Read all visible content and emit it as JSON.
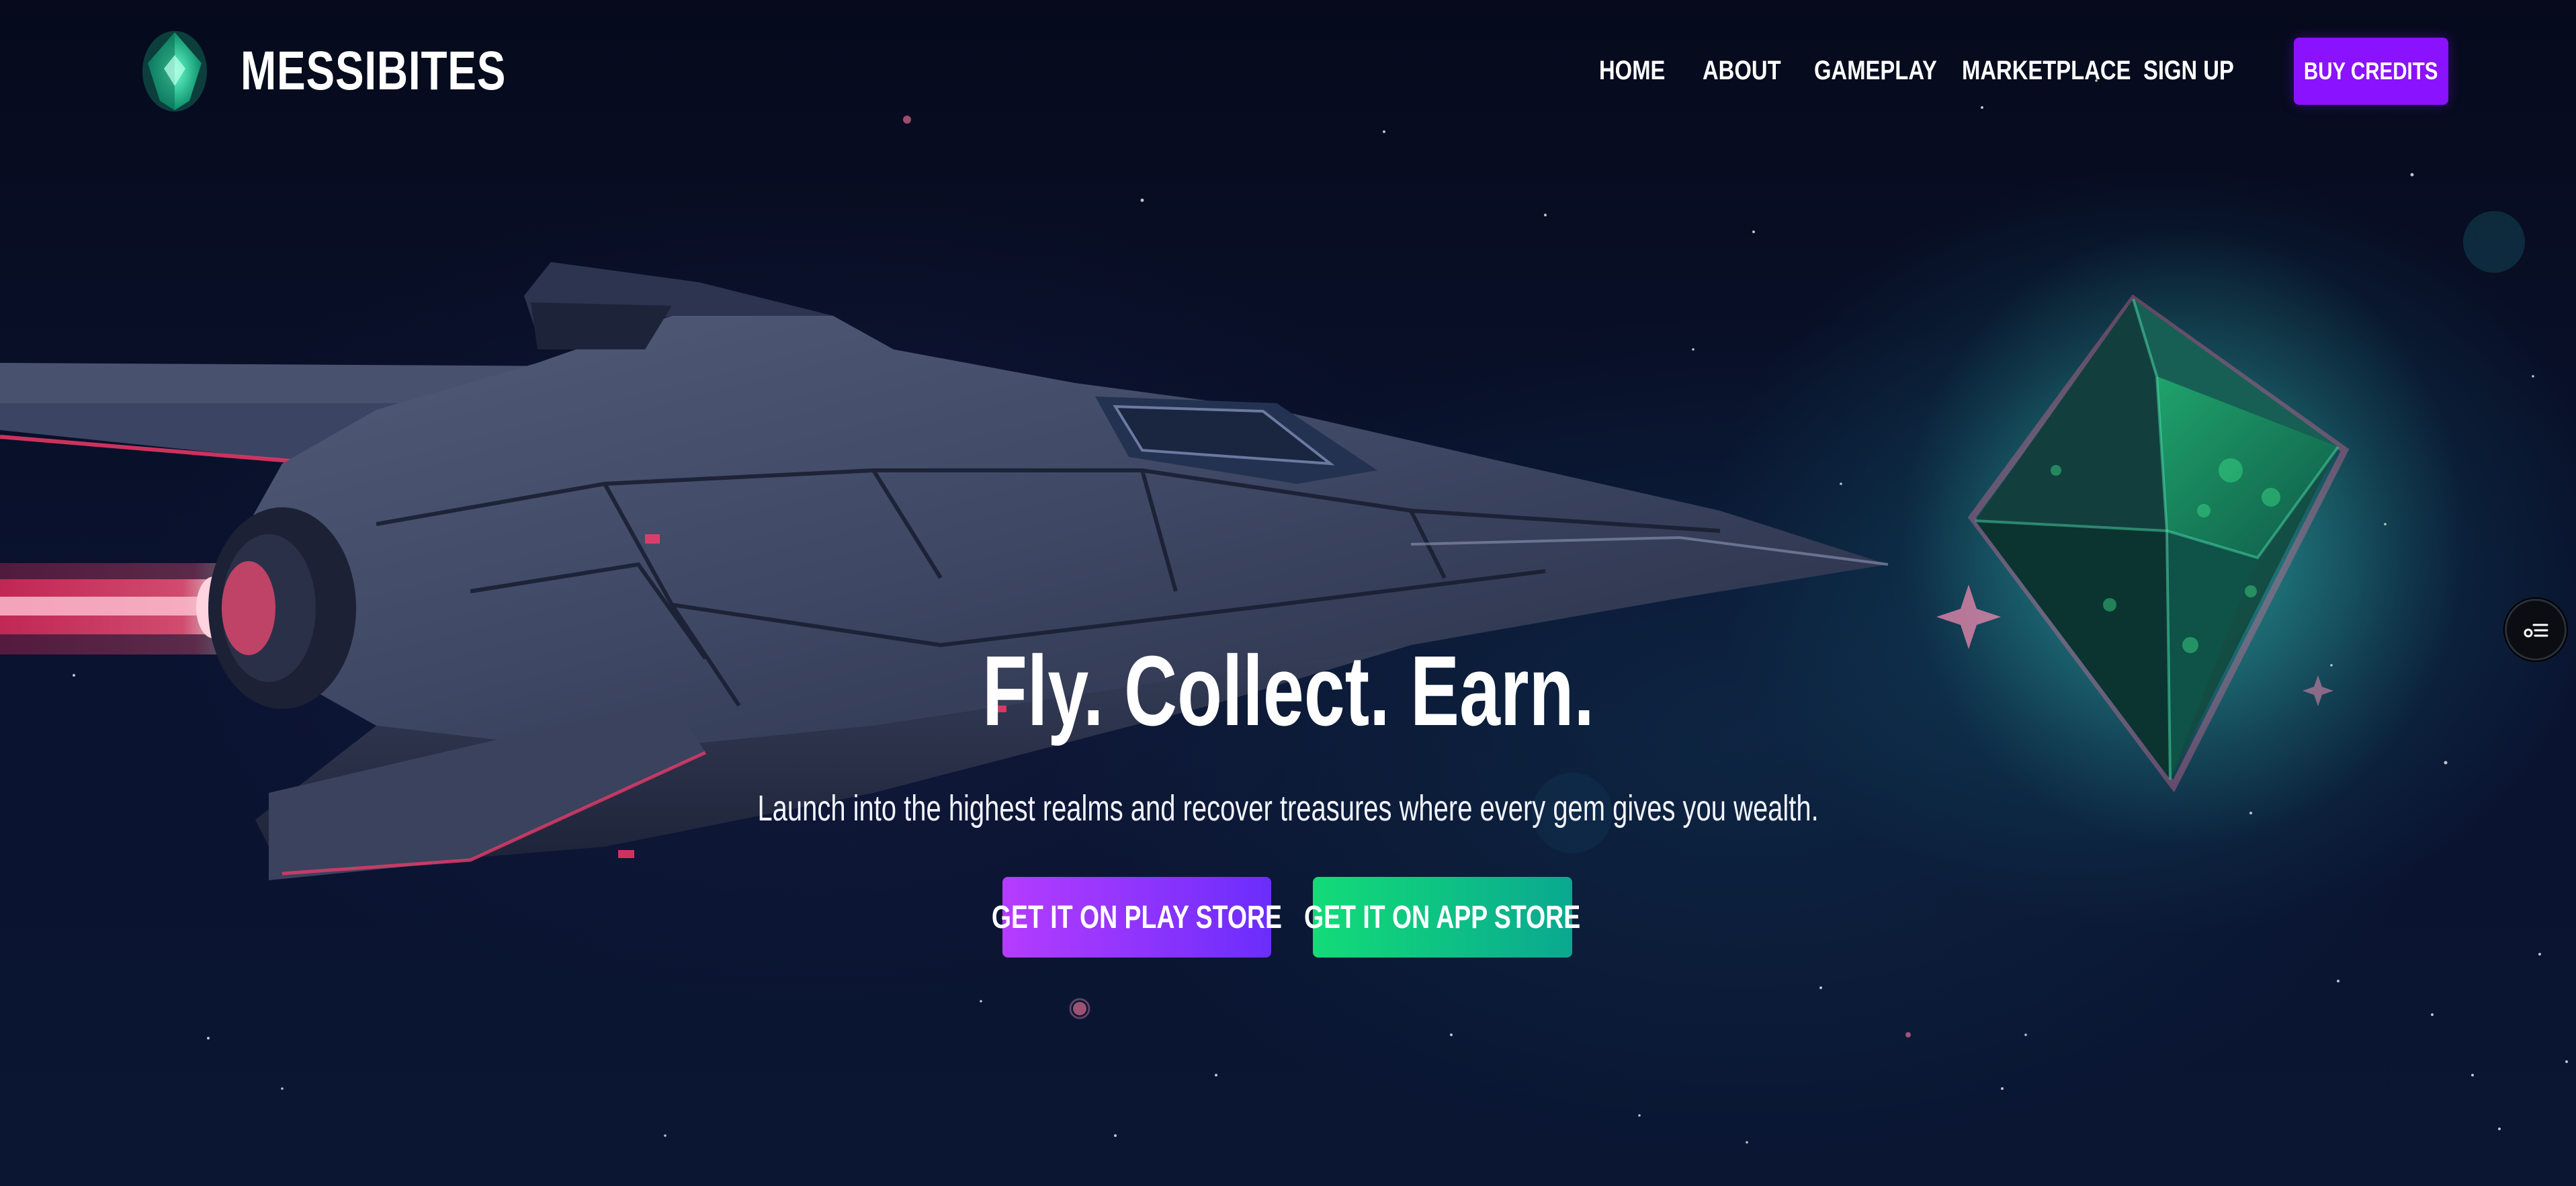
{
  "brand": {
    "name": "MESSIBITES",
    "logo_icon": "green-gem-icon"
  },
  "nav": {
    "items": [
      {
        "label": "HOME"
      },
      {
        "label": "ABOUT"
      },
      {
        "label": "GAMEPLAY"
      },
      {
        "label": "MARKETPLACE"
      },
      {
        "label": "SIGN UP"
      }
    ],
    "cta_label": "BUY CREDITS"
  },
  "hero": {
    "title": "Fly. Collect. Earn.",
    "subtitle": "Launch into the highest realms and recover treasures where every gem gives you wealth.",
    "play_store_label": "GET IT ON PLAY STORE",
    "app_store_label": "GET IT ON APP STORE"
  },
  "side_widget": {
    "icon": "menu-list-icon"
  },
  "colors": {
    "accent_purple": "#8a12ff",
    "play_gradient_start": "#b53cff",
    "play_gradient_end": "#6b2dfb",
    "app_gradient_start": "#12dc77",
    "app_gradient_end": "#0aa890",
    "background": "#070b1f",
    "gem_green": "#1fa36b"
  }
}
